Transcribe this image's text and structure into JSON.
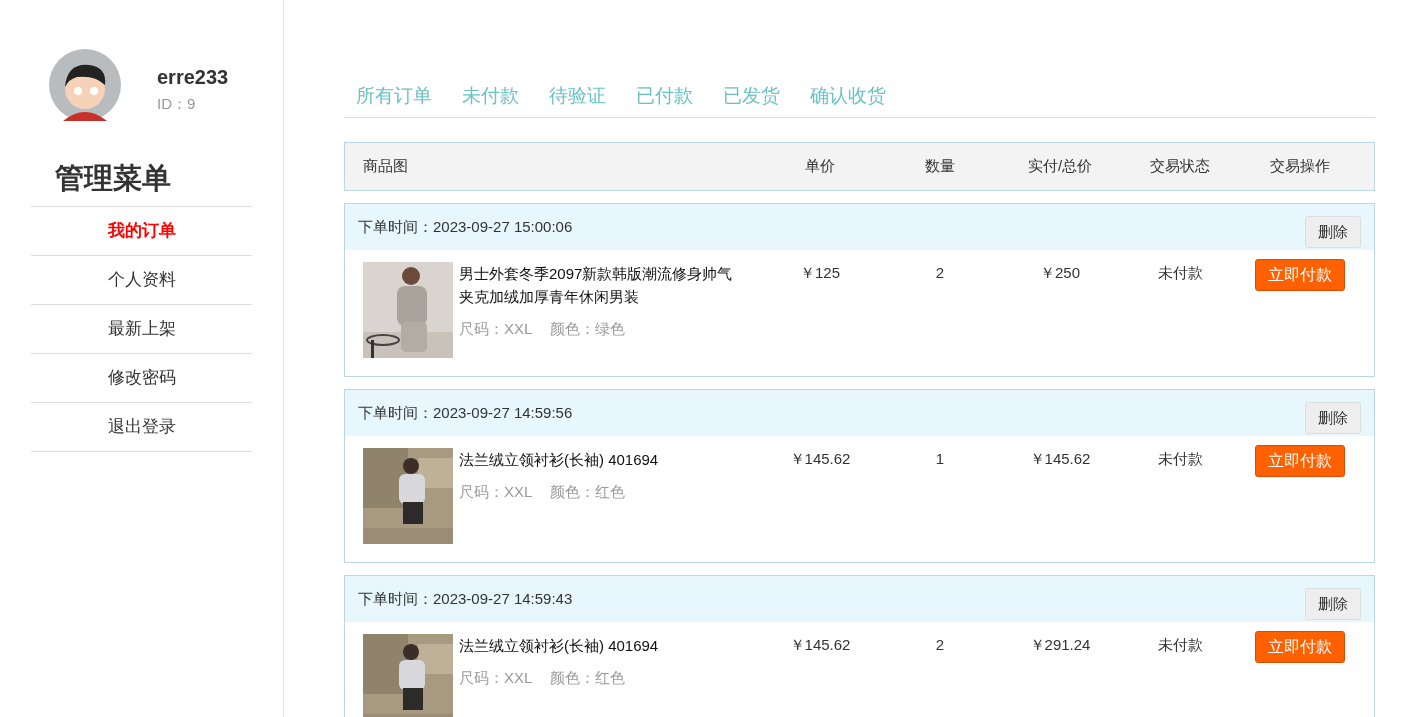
{
  "user": {
    "name": "erre233",
    "id": "ID：9"
  },
  "menu": {
    "title": "管理菜单",
    "items": [
      {
        "label": "我的订单",
        "selected": true
      },
      {
        "label": "个人资料",
        "selected": false
      },
      {
        "label": "最新上架",
        "selected": false
      },
      {
        "label": "修改密码",
        "selected": false
      },
      {
        "label": "退出登录",
        "selected": false
      }
    ]
  },
  "tabs": [
    "所有订单",
    "未付款",
    "待验证",
    "已付款",
    "已发货",
    "确认收货"
  ],
  "table": {
    "columns": [
      "商品图",
      "单价",
      "数量",
      "实付/总价",
      "交易状态",
      "交易操作"
    ]
  },
  "orders": [
    {
      "time": "下单时间：2023-09-27 15:00:06",
      "delete": "删除",
      "title": "男士外套冬季2097新款韩版潮流修身帅气夹克加绒加厚青年休闲男装",
      "size": "尺码：XXL",
      "color_label": "颜色：绿色",
      "price": "￥125",
      "quantity": "2",
      "total": "￥250",
      "status": "未付款",
      "action": "立即付款"
    },
    {
      "time": "下单时间：2023-09-27 14:59:56",
      "delete": "删除",
      "title": "法兰绒立领衬衫(长袖) 401694",
      "size": "尺码：XXL",
      "color_label": "颜色：红色",
      "price": "￥145.62",
      "quantity": "1",
      "total": "￥145.62",
      "status": "未付款",
      "action": "立即付款"
    },
    {
      "time": "下单时间：2023-09-27 14:59:43",
      "delete": "删除",
      "title": "法兰绒立领衬衫(长袖) 401694",
      "size": "尺码：XXL",
      "color_label": "颜色：红色",
      "price": "￥145.62",
      "quantity": "2",
      "total": "￥291.24",
      "status": "未付款",
      "action": "立即付款"
    }
  ]
}
